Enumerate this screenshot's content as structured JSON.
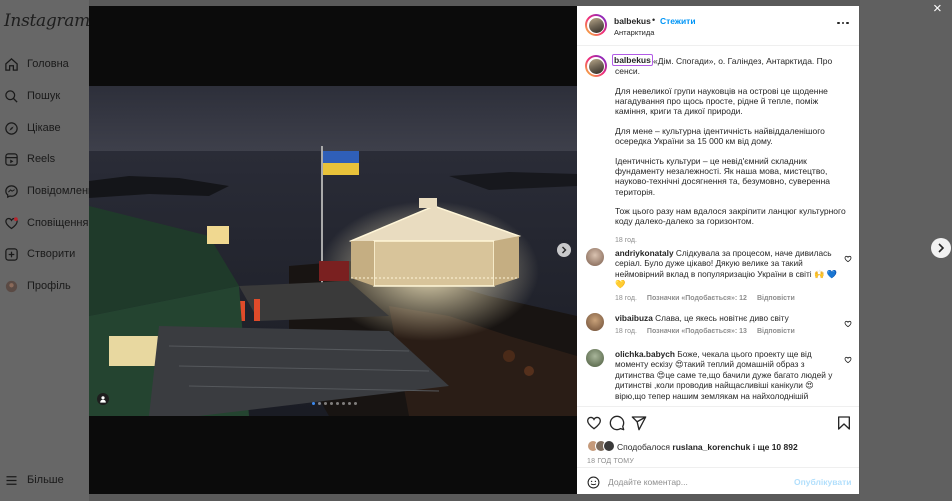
{
  "sidebar": {
    "logo": "Instagram",
    "items": [
      {
        "label": "Головна",
        "icon": "home-icon"
      },
      {
        "label": "Пошук",
        "icon": "search-icon"
      },
      {
        "label": "Цікаве",
        "icon": "compass-icon"
      },
      {
        "label": "Reels",
        "icon": "reels-icon"
      },
      {
        "label": "Повідомлення",
        "icon": "messenger-icon"
      },
      {
        "label": "Сповіщення",
        "icon": "heart-icon"
      },
      {
        "label": "Створити",
        "icon": "plus-square-icon"
      },
      {
        "label": "Профіль",
        "icon": "profile-avatar"
      }
    ],
    "more_label": "Більше"
  },
  "post": {
    "header": {
      "username": "balbekus",
      "separator": "•",
      "follow_label": "Стежити",
      "location": "Антарктида"
    },
    "caption": {
      "username": "balbekus",
      "paragraphs": [
        "«Дім. Спогади», о. Галіндез, Антарктида. Про сенси.",
        "Для невеликої групи науковців на острові це щоденне нагадування про щось просте, рідне й тепле, поміж каміння, криги та дикої природи.",
        "Для мене – культурна ідентичність найвіддаленішого осередка України за 15 000 км від дому.",
        "Ідентичність культури – це невід'ємний складник фундаменту незалежності. Як наша мова, мистецтво, науково-технічні досягнення та, безумовно, суверенна територія.",
        "Тож цього разу нам вдалося закріпити ланцюг культурного коду далеко-далеко за горизонтом."
      ],
      "time": "18 год."
    },
    "comments": [
      {
        "username": "andriykonataly",
        "text": "Слідкувала за процесом, наче дивилась серіал. Було дуже цікаво! Дякую велике за такий неймовірний вклад в популяризацію України в світі 🙌 💙💛",
        "time": "18 год.",
        "likes": "Позначки «Подобається»: 12",
        "reply": "Відповісти"
      },
      {
        "username": "vibaibuza",
        "text": "Слава, це якесь новітнє диво світу",
        "time": "18 год.",
        "likes": "Позначки «Подобається»: 13",
        "reply": "Відповісти"
      },
      {
        "username": "olichka.babych",
        "text": "Боже, чекала цього проекту ще від моменту ескізу 😍такий теплий домашній образ з дитинства 😍це саме те,що бачили дуже багато людей у дитинстві ,коли проводив найщасливіші канікули 😍 вірю,що тепер нашим землякам на найхолоднішій",
        "time": "",
        "likes": "",
        "reply": ""
      }
    ],
    "likes": {
      "prefix": "Сподобалося",
      "user": "ruslana_korenchuk",
      "suffix": "і ще 10 892"
    },
    "time_ago": "18 ГОД ТОМУ",
    "comment_input_placeholder": "Додайте коментар...",
    "publish_label": "Опублікувати",
    "carousel_dots": 8,
    "carousel_active": 0
  },
  "close_label": "×",
  "colors": {
    "accent": "#0095f6",
    "publish_disabled": "#b2dffc",
    "avatar_ring": "#ee2a7b",
    "highlight_border": "#b25be6"
  }
}
